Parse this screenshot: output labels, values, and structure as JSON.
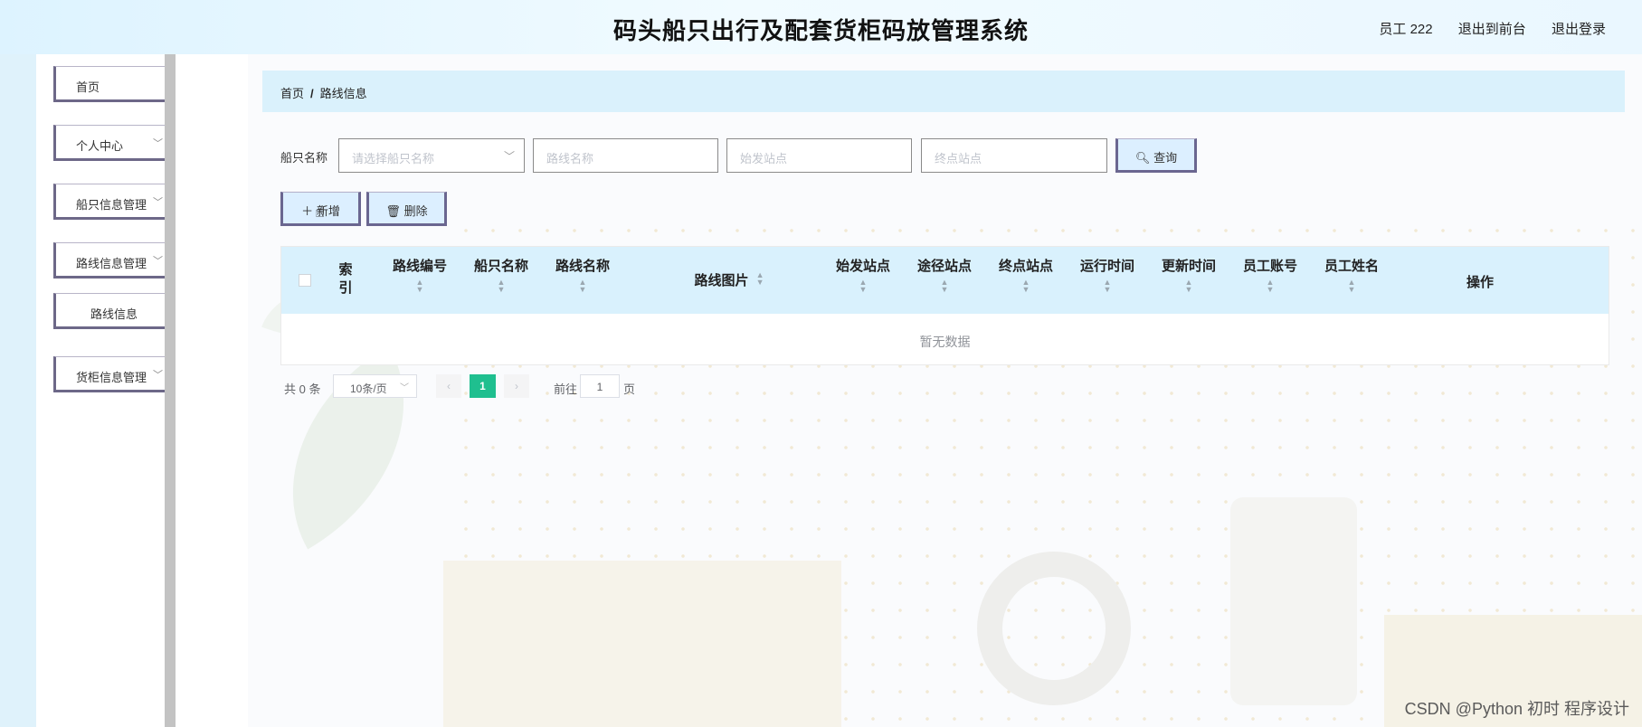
{
  "header": {
    "title": "码头船只出行及配套货柜码放管理系统",
    "user": "员工 222",
    "to_front": "退出到前台",
    "logout": "退出登录"
  },
  "sidebar": {
    "items": [
      {
        "label": "首页",
        "has_chevron": false
      },
      {
        "label": "个人中心",
        "has_chevron": true
      },
      {
        "label": "船只信息管理",
        "has_chevron": true
      },
      {
        "label": "路线信息管理",
        "has_chevron": true
      },
      {
        "label": "路线信息",
        "has_chevron": false
      },
      {
        "label": "货柜信息管理",
        "has_chevron": true
      }
    ]
  },
  "breadcrumb": {
    "home": "首页",
    "separator": "/",
    "current": "路线信息"
  },
  "search": {
    "label": "船只名称",
    "ship_placeholder": "请选择船只名称",
    "route_placeholder": "路线名称",
    "start_placeholder": "始发站点",
    "end_placeholder": "终点站点",
    "query_label": "查询"
  },
  "actions": {
    "add_label": "新增",
    "delete_label": "删除"
  },
  "table": {
    "columns": [
      "索引",
      "路线编号",
      "船只名称",
      "路线名称",
      "路线图片",
      "始发站点",
      "途径站点",
      "终点站点",
      "运行时间",
      "更新时间",
      "员工账号",
      "员工姓名",
      "操作"
    ],
    "index_lines": [
      "索",
      "引"
    ],
    "empty_text": "暂无数据"
  },
  "pagination": {
    "total_text": "共 0 条",
    "page_size": "10条/页",
    "current_page": "1",
    "goto_label": "前往",
    "goto_value": "1",
    "page_suffix": "页"
  },
  "watermark": "CSDN @Python 初时 程序设计",
  "colors": {
    "accent": "#1fbf8f",
    "header_bg": "#d9f1fd",
    "button_border": "#6a6690"
  },
  "icons": {
    "query": "search-icon",
    "add": "plus-icon",
    "delete": "trash-icon",
    "chevron": "chevron-down-icon"
  }
}
